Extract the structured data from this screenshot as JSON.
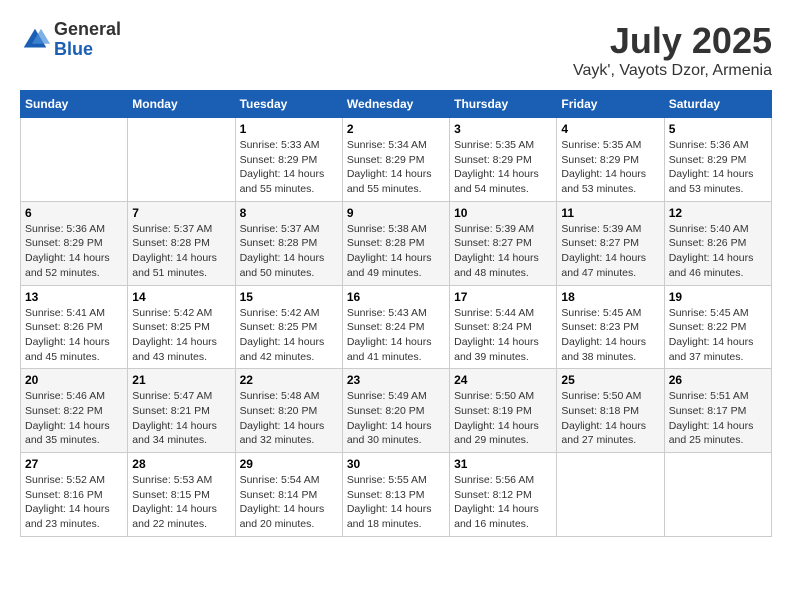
{
  "header": {
    "logo_general": "General",
    "logo_blue": "Blue",
    "month_title": "July 2025",
    "location": "Vayk', Vayots Dzor, Armenia"
  },
  "weekdays": [
    "Sunday",
    "Monday",
    "Tuesday",
    "Wednesday",
    "Thursday",
    "Friday",
    "Saturday"
  ],
  "weeks": [
    [
      {
        "day": "",
        "info": ""
      },
      {
        "day": "",
        "info": ""
      },
      {
        "day": "1",
        "sunrise": "5:33 AM",
        "sunset": "8:29 PM",
        "daylight": "14 hours and 55 minutes."
      },
      {
        "day": "2",
        "sunrise": "5:34 AM",
        "sunset": "8:29 PM",
        "daylight": "14 hours and 55 minutes."
      },
      {
        "day": "3",
        "sunrise": "5:35 AM",
        "sunset": "8:29 PM",
        "daylight": "14 hours and 54 minutes."
      },
      {
        "day": "4",
        "sunrise": "5:35 AM",
        "sunset": "8:29 PM",
        "daylight": "14 hours and 53 minutes."
      },
      {
        "day": "5",
        "sunrise": "5:36 AM",
        "sunset": "8:29 PM",
        "daylight": "14 hours and 53 minutes."
      }
    ],
    [
      {
        "day": "6",
        "sunrise": "5:36 AM",
        "sunset": "8:29 PM",
        "daylight": "14 hours and 52 minutes."
      },
      {
        "day": "7",
        "sunrise": "5:37 AM",
        "sunset": "8:28 PM",
        "daylight": "14 hours and 51 minutes."
      },
      {
        "day": "8",
        "sunrise": "5:37 AM",
        "sunset": "8:28 PM",
        "daylight": "14 hours and 50 minutes."
      },
      {
        "day": "9",
        "sunrise": "5:38 AM",
        "sunset": "8:28 PM",
        "daylight": "14 hours and 49 minutes."
      },
      {
        "day": "10",
        "sunrise": "5:39 AM",
        "sunset": "8:27 PM",
        "daylight": "14 hours and 48 minutes."
      },
      {
        "day": "11",
        "sunrise": "5:39 AM",
        "sunset": "8:27 PM",
        "daylight": "14 hours and 47 minutes."
      },
      {
        "day": "12",
        "sunrise": "5:40 AM",
        "sunset": "8:26 PM",
        "daylight": "14 hours and 46 minutes."
      }
    ],
    [
      {
        "day": "13",
        "sunrise": "5:41 AM",
        "sunset": "8:26 PM",
        "daylight": "14 hours and 45 minutes."
      },
      {
        "day": "14",
        "sunrise": "5:42 AM",
        "sunset": "8:25 PM",
        "daylight": "14 hours and 43 minutes."
      },
      {
        "day": "15",
        "sunrise": "5:42 AM",
        "sunset": "8:25 PM",
        "daylight": "14 hours and 42 minutes."
      },
      {
        "day": "16",
        "sunrise": "5:43 AM",
        "sunset": "8:24 PM",
        "daylight": "14 hours and 41 minutes."
      },
      {
        "day": "17",
        "sunrise": "5:44 AM",
        "sunset": "8:24 PM",
        "daylight": "14 hours and 39 minutes."
      },
      {
        "day": "18",
        "sunrise": "5:45 AM",
        "sunset": "8:23 PM",
        "daylight": "14 hours and 38 minutes."
      },
      {
        "day": "19",
        "sunrise": "5:45 AM",
        "sunset": "8:22 PM",
        "daylight": "14 hours and 37 minutes."
      }
    ],
    [
      {
        "day": "20",
        "sunrise": "5:46 AM",
        "sunset": "8:22 PM",
        "daylight": "14 hours and 35 minutes."
      },
      {
        "day": "21",
        "sunrise": "5:47 AM",
        "sunset": "8:21 PM",
        "daylight": "14 hours and 34 minutes."
      },
      {
        "day": "22",
        "sunrise": "5:48 AM",
        "sunset": "8:20 PM",
        "daylight": "14 hours and 32 minutes."
      },
      {
        "day": "23",
        "sunrise": "5:49 AM",
        "sunset": "8:20 PM",
        "daylight": "14 hours and 30 minutes."
      },
      {
        "day": "24",
        "sunrise": "5:50 AM",
        "sunset": "8:19 PM",
        "daylight": "14 hours and 29 minutes."
      },
      {
        "day": "25",
        "sunrise": "5:50 AM",
        "sunset": "8:18 PM",
        "daylight": "14 hours and 27 minutes."
      },
      {
        "day": "26",
        "sunrise": "5:51 AM",
        "sunset": "8:17 PM",
        "daylight": "14 hours and 25 minutes."
      }
    ],
    [
      {
        "day": "27",
        "sunrise": "5:52 AM",
        "sunset": "8:16 PM",
        "daylight": "14 hours and 23 minutes."
      },
      {
        "day": "28",
        "sunrise": "5:53 AM",
        "sunset": "8:15 PM",
        "daylight": "14 hours and 22 minutes."
      },
      {
        "day": "29",
        "sunrise": "5:54 AM",
        "sunset": "8:14 PM",
        "daylight": "14 hours and 20 minutes."
      },
      {
        "day": "30",
        "sunrise": "5:55 AM",
        "sunset": "8:13 PM",
        "daylight": "14 hours and 18 minutes."
      },
      {
        "day": "31",
        "sunrise": "5:56 AM",
        "sunset": "8:12 PM",
        "daylight": "14 hours and 16 minutes."
      },
      {
        "day": "",
        "info": ""
      },
      {
        "day": "",
        "info": ""
      }
    ]
  ]
}
